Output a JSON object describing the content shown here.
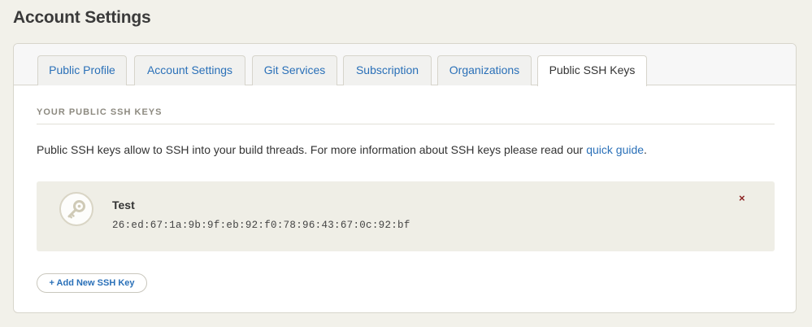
{
  "page": {
    "title": "Account Settings"
  },
  "tabs": [
    {
      "label": "Public Profile",
      "active": false
    },
    {
      "label": "Account Settings",
      "active": false
    },
    {
      "label": "Git Services",
      "active": false
    },
    {
      "label": "Subscription",
      "active": false
    },
    {
      "label": "Organizations",
      "active": false
    },
    {
      "label": "Public SSH Keys",
      "active": true
    }
  ],
  "section": {
    "heading": "YOUR PUBLIC SSH KEYS",
    "description_prefix": "Public SSH keys allow to SSH into your build threads. For more information about SSH keys please read our ",
    "description_link": "quick guide",
    "description_suffix": "."
  },
  "keys": [
    {
      "name": "Test",
      "fingerprint": "26:ed:67:1a:9b:9f:eb:92:f0:78:96:43:67:0c:92:bf",
      "icon": "key-icon",
      "delete_label": "×"
    }
  ],
  "actions": {
    "add_key_label": "+ Add New SSH Key"
  },
  "colors": {
    "link": "#2a70b8",
    "background": "#f2f1ea",
    "card": "#efeee6",
    "delete": "#8a1f1f"
  }
}
